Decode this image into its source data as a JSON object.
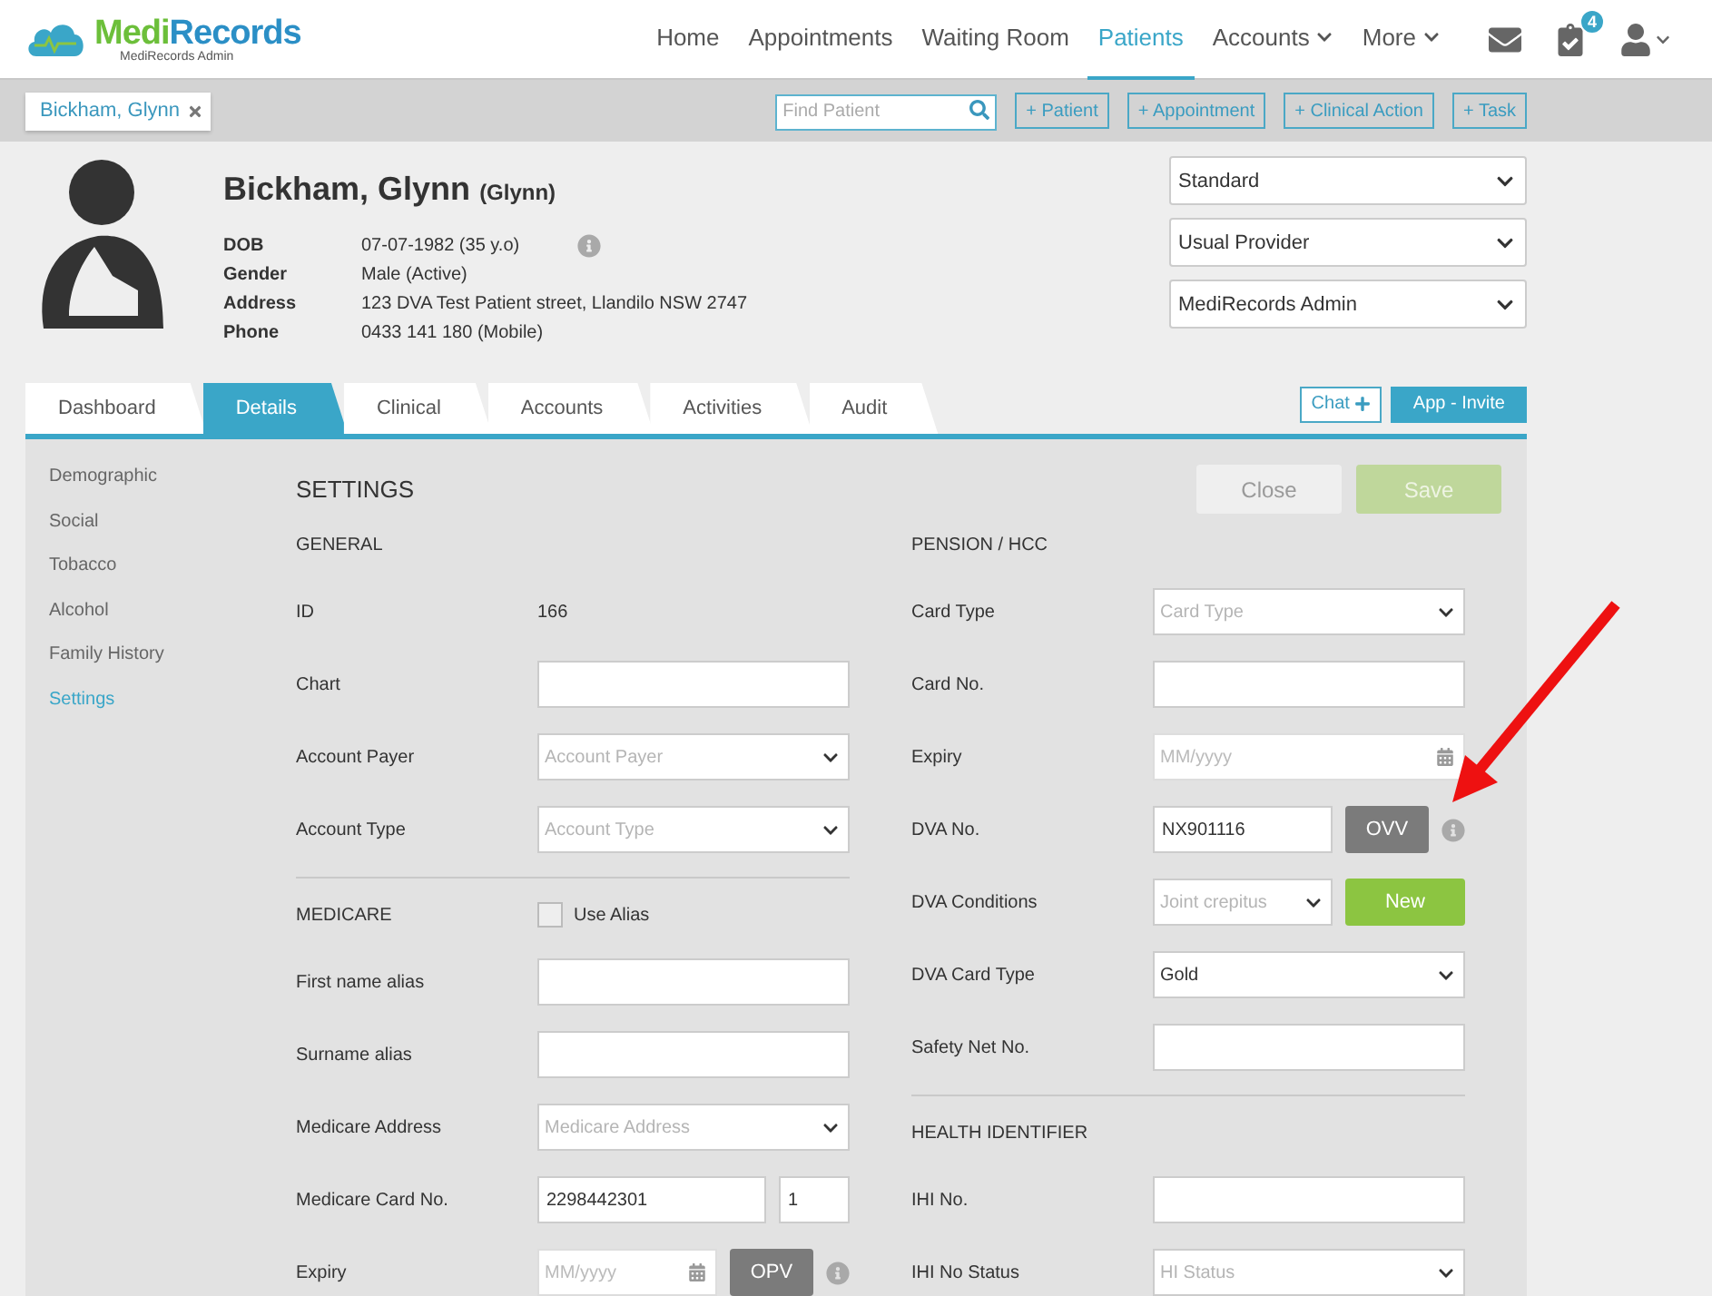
{
  "header": {
    "logo": {
      "prefix": "Medi",
      "suffix": "Records",
      "subtitle": "MediRecords Admin"
    },
    "nav": [
      {
        "label": "Home",
        "selected": false,
        "dropdown": false
      },
      {
        "label": "Appointments",
        "selected": false,
        "dropdown": false
      },
      {
        "label": "Waiting Room",
        "selected": false,
        "dropdown": false
      },
      {
        "label": "Patients",
        "selected": true,
        "dropdown": false
      },
      {
        "label": "Accounts",
        "selected": false,
        "dropdown": true
      },
      {
        "label": "More",
        "selected": false,
        "dropdown": true
      }
    ],
    "tasks_badge": "4"
  },
  "toolbar": {
    "patient_tab": "Bickham, Glynn",
    "search": {
      "placeholder": "Find Patient"
    },
    "buttons": [
      "+ Patient",
      "+ Appointment",
      "+ Clinical Action",
      "+ Task"
    ]
  },
  "patient": {
    "name": "Bickham, Glynn",
    "alias": "(Glynn)",
    "details": [
      {
        "label": "DOB",
        "value": "07-07-1982 (35 y.o)",
        "info": true
      },
      {
        "label": "Gender",
        "value": "Male (Active)"
      },
      {
        "label": "Address",
        "value": "123 DVA Test Patient street, Llandilo NSW 2747"
      },
      {
        "label": "Phone",
        "value": "0433 141 180 (Mobile)"
      }
    ],
    "selects": [
      "Standard",
      "Usual Provider",
      "MediRecords Admin"
    ]
  },
  "tabs": [
    {
      "label": "Dashboard",
      "selected": false
    },
    {
      "label": "Details",
      "selected": true
    },
    {
      "label": "Clinical",
      "selected": false
    },
    {
      "label": "Accounts",
      "selected": false
    },
    {
      "label": "Activities",
      "selected": false
    },
    {
      "label": "Audit",
      "selected": false
    }
  ],
  "tab_actions": {
    "chat": "Chat",
    "invite": "App - Invite"
  },
  "side_menu": [
    {
      "label": "Demographic",
      "selected": false
    },
    {
      "label": "Social",
      "selected": false
    },
    {
      "label": "Tobacco",
      "selected": false
    },
    {
      "label": "Alcohol",
      "selected": false
    },
    {
      "label": "Family History",
      "selected": false
    },
    {
      "label": "Settings",
      "selected": true
    }
  ],
  "settings": {
    "title": "SETTINGS",
    "actions": [
      {
        "label": "Close",
        "kind": "grey",
        "disabled": true
      },
      {
        "label": "Save",
        "kind": "green",
        "disabled": true
      }
    ],
    "left": [
      {
        "kind": "section",
        "label": "GENERAL"
      },
      {
        "kind": "static",
        "label": "ID",
        "value": "166"
      },
      {
        "kind": "input",
        "label": "Chart"
      },
      {
        "kind": "select",
        "label": "Account Payer",
        "placeholder": "Account Payer"
      },
      {
        "kind": "select",
        "label": "Account Type",
        "placeholder": "Account Type"
      },
      {
        "kind": "divider"
      },
      {
        "kind": "section",
        "label": "MEDICARE",
        "checkbox": {
          "label": "Use Alias",
          "checked": false
        }
      },
      {
        "kind": "input",
        "label": "First name alias"
      },
      {
        "kind": "input",
        "label": "Surname alias"
      },
      {
        "kind": "select",
        "label": "Medicare Address",
        "placeholder": "Medicare Address"
      },
      {
        "kind": "pair",
        "label": "Medicare Card No.",
        "value": "2298442301",
        "second_value": "1"
      },
      {
        "kind": "date",
        "label": "Expiry",
        "placeholder": "MM/yyyy",
        "button": {
          "label": "OPV",
          "kind": "grey",
          "disabled": false
        },
        "info": true
      }
    ],
    "right": [
      {
        "kind": "section",
        "label": "PENSION / HCC"
      },
      {
        "kind": "select",
        "label": "Card Type",
        "placeholder": "Card Type"
      },
      {
        "kind": "input",
        "label": "Card No."
      },
      {
        "kind": "date",
        "label": "Expiry",
        "placeholder": "MM/yyyy"
      },
      {
        "kind": "input",
        "label": "DVA No.",
        "value": "NX901116",
        "button": {
          "label": "OVV",
          "kind": "grey",
          "disabled": false
        },
        "info": true
      },
      {
        "kind": "select",
        "label": "DVA Conditions",
        "placeholder": "Joint crepitus",
        "button": {
          "label": "New",
          "kind": "green",
          "disabled": false
        }
      },
      {
        "kind": "select",
        "label": "DVA Card Type",
        "value": "Gold"
      },
      {
        "kind": "input",
        "label": "Safety Net No."
      },
      {
        "kind": "divider"
      },
      {
        "kind": "section",
        "label": "HEALTH IDENTIFIER"
      },
      {
        "kind": "input",
        "label": "IHI No."
      },
      {
        "kind": "select",
        "label": "IHI No Status",
        "placeholder": "HI Status"
      }
    ]
  }
}
